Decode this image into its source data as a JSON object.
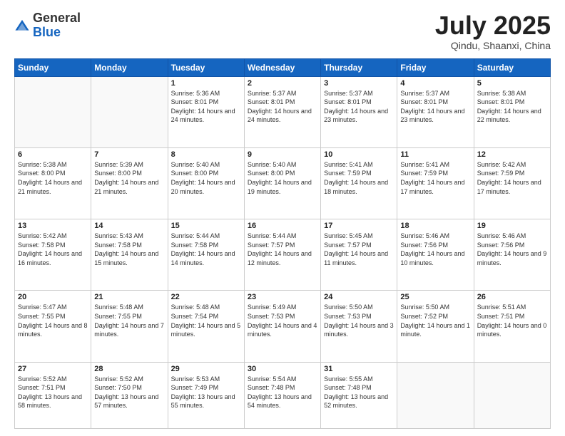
{
  "header": {
    "logo_general": "General",
    "logo_blue": "Blue",
    "month_title": "July 2025",
    "location": "Qindu, Shaanxi, China"
  },
  "weekdays": [
    "Sunday",
    "Monday",
    "Tuesday",
    "Wednesday",
    "Thursday",
    "Friday",
    "Saturday"
  ],
  "weeks": [
    [
      {
        "day": "",
        "sunrise": "",
        "sunset": "",
        "daylight": ""
      },
      {
        "day": "",
        "sunrise": "",
        "sunset": "",
        "daylight": ""
      },
      {
        "day": "1",
        "sunrise": "Sunrise: 5:36 AM",
        "sunset": "Sunset: 8:01 PM",
        "daylight": "Daylight: 14 hours and 24 minutes."
      },
      {
        "day": "2",
        "sunrise": "Sunrise: 5:37 AM",
        "sunset": "Sunset: 8:01 PM",
        "daylight": "Daylight: 14 hours and 24 minutes."
      },
      {
        "day": "3",
        "sunrise": "Sunrise: 5:37 AM",
        "sunset": "Sunset: 8:01 PM",
        "daylight": "Daylight: 14 hours and 23 minutes."
      },
      {
        "day": "4",
        "sunrise": "Sunrise: 5:37 AM",
        "sunset": "Sunset: 8:01 PM",
        "daylight": "Daylight: 14 hours and 23 minutes."
      },
      {
        "day": "5",
        "sunrise": "Sunrise: 5:38 AM",
        "sunset": "Sunset: 8:01 PM",
        "daylight": "Daylight: 14 hours and 22 minutes."
      }
    ],
    [
      {
        "day": "6",
        "sunrise": "Sunrise: 5:38 AM",
        "sunset": "Sunset: 8:00 PM",
        "daylight": "Daylight: 14 hours and 21 minutes."
      },
      {
        "day": "7",
        "sunrise": "Sunrise: 5:39 AM",
        "sunset": "Sunset: 8:00 PM",
        "daylight": "Daylight: 14 hours and 21 minutes."
      },
      {
        "day": "8",
        "sunrise": "Sunrise: 5:40 AM",
        "sunset": "Sunset: 8:00 PM",
        "daylight": "Daylight: 14 hours and 20 minutes."
      },
      {
        "day": "9",
        "sunrise": "Sunrise: 5:40 AM",
        "sunset": "Sunset: 8:00 PM",
        "daylight": "Daylight: 14 hours and 19 minutes."
      },
      {
        "day": "10",
        "sunrise": "Sunrise: 5:41 AM",
        "sunset": "Sunset: 7:59 PM",
        "daylight": "Daylight: 14 hours and 18 minutes."
      },
      {
        "day": "11",
        "sunrise": "Sunrise: 5:41 AM",
        "sunset": "Sunset: 7:59 PM",
        "daylight": "Daylight: 14 hours and 17 minutes."
      },
      {
        "day": "12",
        "sunrise": "Sunrise: 5:42 AM",
        "sunset": "Sunset: 7:59 PM",
        "daylight": "Daylight: 14 hours and 17 minutes."
      }
    ],
    [
      {
        "day": "13",
        "sunrise": "Sunrise: 5:42 AM",
        "sunset": "Sunset: 7:58 PM",
        "daylight": "Daylight: 14 hours and 16 minutes."
      },
      {
        "day": "14",
        "sunrise": "Sunrise: 5:43 AM",
        "sunset": "Sunset: 7:58 PM",
        "daylight": "Daylight: 14 hours and 15 minutes."
      },
      {
        "day": "15",
        "sunrise": "Sunrise: 5:44 AM",
        "sunset": "Sunset: 7:58 PM",
        "daylight": "Daylight: 14 hours and 14 minutes."
      },
      {
        "day": "16",
        "sunrise": "Sunrise: 5:44 AM",
        "sunset": "Sunset: 7:57 PM",
        "daylight": "Daylight: 14 hours and 12 minutes."
      },
      {
        "day": "17",
        "sunrise": "Sunrise: 5:45 AM",
        "sunset": "Sunset: 7:57 PM",
        "daylight": "Daylight: 14 hours and 11 minutes."
      },
      {
        "day": "18",
        "sunrise": "Sunrise: 5:46 AM",
        "sunset": "Sunset: 7:56 PM",
        "daylight": "Daylight: 14 hours and 10 minutes."
      },
      {
        "day": "19",
        "sunrise": "Sunrise: 5:46 AM",
        "sunset": "Sunset: 7:56 PM",
        "daylight": "Daylight: 14 hours and 9 minutes."
      }
    ],
    [
      {
        "day": "20",
        "sunrise": "Sunrise: 5:47 AM",
        "sunset": "Sunset: 7:55 PM",
        "daylight": "Daylight: 14 hours and 8 minutes."
      },
      {
        "day": "21",
        "sunrise": "Sunrise: 5:48 AM",
        "sunset": "Sunset: 7:55 PM",
        "daylight": "Daylight: 14 hours and 7 minutes."
      },
      {
        "day": "22",
        "sunrise": "Sunrise: 5:48 AM",
        "sunset": "Sunset: 7:54 PM",
        "daylight": "Daylight: 14 hours and 5 minutes."
      },
      {
        "day": "23",
        "sunrise": "Sunrise: 5:49 AM",
        "sunset": "Sunset: 7:53 PM",
        "daylight": "Daylight: 14 hours and 4 minutes."
      },
      {
        "day": "24",
        "sunrise": "Sunrise: 5:50 AM",
        "sunset": "Sunset: 7:53 PM",
        "daylight": "Daylight: 14 hours and 3 minutes."
      },
      {
        "day": "25",
        "sunrise": "Sunrise: 5:50 AM",
        "sunset": "Sunset: 7:52 PM",
        "daylight": "Daylight: 14 hours and 1 minute."
      },
      {
        "day": "26",
        "sunrise": "Sunrise: 5:51 AM",
        "sunset": "Sunset: 7:51 PM",
        "daylight": "Daylight: 14 hours and 0 minutes."
      }
    ],
    [
      {
        "day": "27",
        "sunrise": "Sunrise: 5:52 AM",
        "sunset": "Sunset: 7:51 PM",
        "daylight": "Daylight: 13 hours and 58 minutes."
      },
      {
        "day": "28",
        "sunrise": "Sunrise: 5:52 AM",
        "sunset": "Sunset: 7:50 PM",
        "daylight": "Daylight: 13 hours and 57 minutes."
      },
      {
        "day": "29",
        "sunrise": "Sunrise: 5:53 AM",
        "sunset": "Sunset: 7:49 PM",
        "daylight": "Daylight: 13 hours and 55 minutes."
      },
      {
        "day": "30",
        "sunrise": "Sunrise: 5:54 AM",
        "sunset": "Sunset: 7:48 PM",
        "daylight": "Daylight: 13 hours and 54 minutes."
      },
      {
        "day": "31",
        "sunrise": "Sunrise: 5:55 AM",
        "sunset": "Sunset: 7:48 PM",
        "daylight": "Daylight: 13 hours and 52 minutes."
      },
      {
        "day": "",
        "sunrise": "",
        "sunset": "",
        "daylight": ""
      },
      {
        "day": "",
        "sunrise": "",
        "sunset": "",
        "daylight": ""
      }
    ]
  ]
}
